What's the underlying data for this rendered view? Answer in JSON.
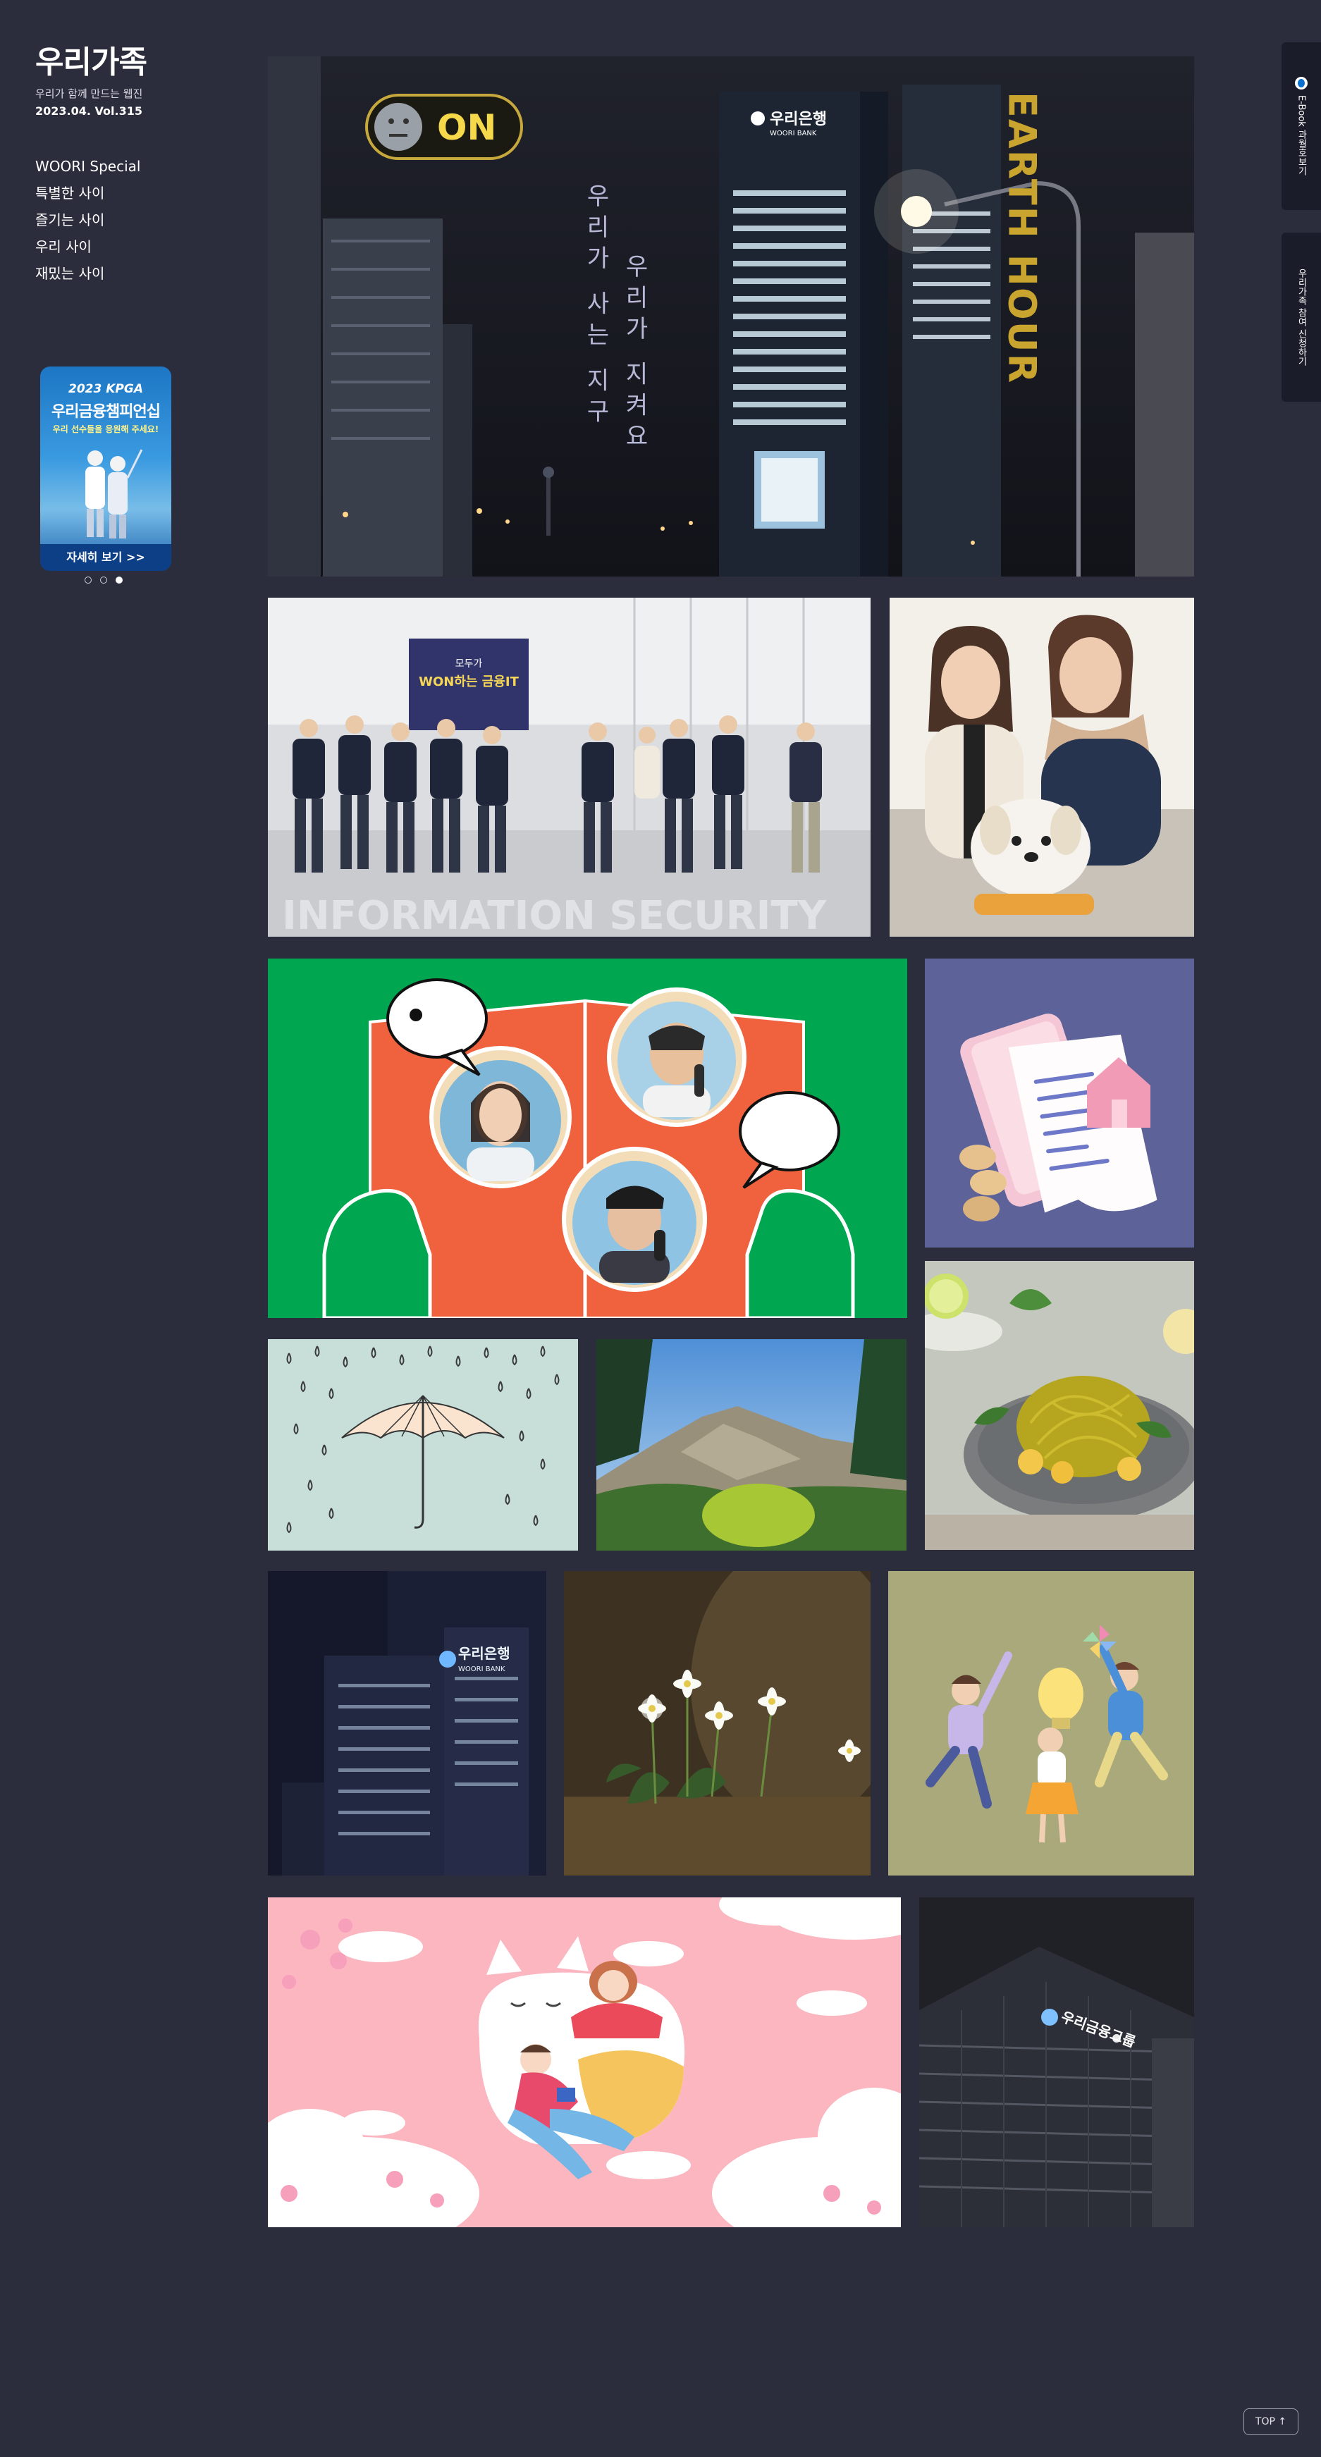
{
  "site": {
    "logo": "우리가족",
    "tagline": "우리가 함께 만드는 웹진",
    "issue": "2023.04. Vol.315"
  },
  "nav": {
    "items": [
      "WOORI Special",
      "특별한 사이",
      "즐기는 사이",
      "우리 사이",
      "재밌는 사이"
    ]
  },
  "banner": {
    "top": "2023 KPGA",
    "title": "우리금융챔피언십",
    "subtitle": "우리 선수들을 응원해 주세요!",
    "button": "자세히 보기 >>",
    "slide_count": 3,
    "active_slide": 3
  },
  "tiles": {
    "hero": {
      "on_badge": "ON",
      "sign_bank_kr": "우리은행",
      "sign_bank_en": "WOORI BANK",
      "vertical_text_1": "우리가 사는 지구",
      "vertical_text_2": "우리가 지켜요",
      "earth_hour": "EARTH HOUR"
    },
    "team": {
      "banner_line1": "모두가",
      "banner_line2": "WON하는 금융IT",
      "caption": "INFORMATION SECURITY"
    },
    "bank": {
      "sign_kr": "우리은행",
      "sign_en": "WOORI BANK"
    },
    "tower": {
      "sign": "우리금융그룹"
    }
  },
  "side_tabs": {
    "ebook": "E-Book 과월호보기",
    "apply": "우리가족 참여 신청하기"
  },
  "top_button": "TOP ↑",
  "colors": {
    "background": "#2b2c3c",
    "banner_blue": "#1d76c4",
    "radio_green": "#00a650",
    "radio_orange": "#f0623d",
    "loan_purple": "#5d6299",
    "cat_pink": "#fbb6c0",
    "olive": "#a9a97c"
  }
}
